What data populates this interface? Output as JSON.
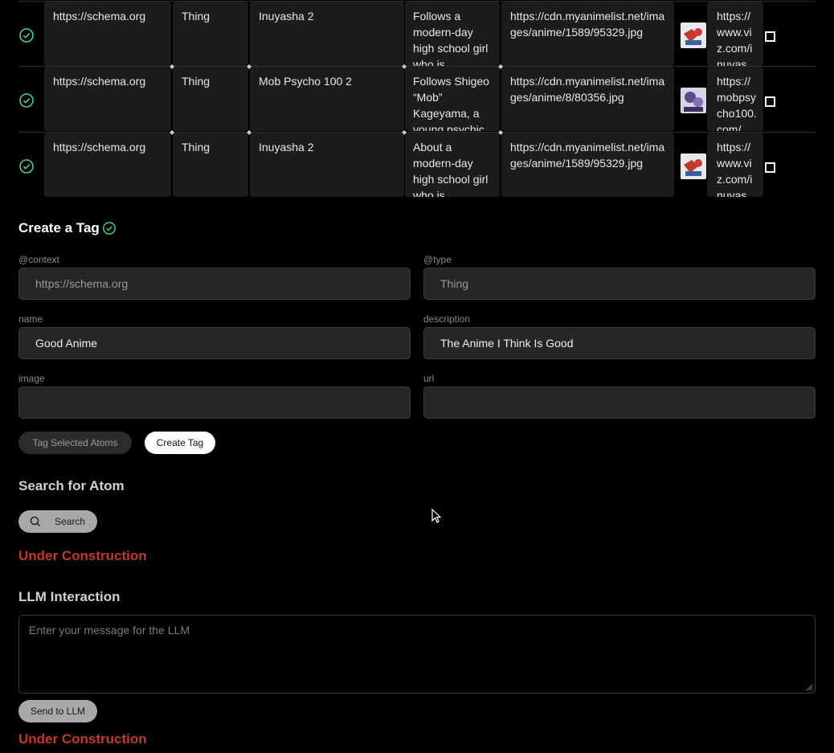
{
  "rows": [
    {
      "context": "https://schema.org",
      "type": "Thing",
      "name": "Inuyasha 2",
      "description": "Follows a modern-day high school girl who is",
      "image": "https://cdn.myanimelist.net/images/anime/1589/95329.jpg",
      "url": "https://www.viz.com/inuyas",
      "thumb_color": "#c0392b"
    },
    {
      "context": "https://schema.org",
      "type": "Thing",
      "name": "Mob Psycho 100 2",
      "description": "Follows Shigeo “Mob” Kageyama, a young psychic",
      "image": "https://cdn.myanimelist.net/images/anime/8/80356.jpg",
      "url": "https://mobpsycho100.com/",
      "thumb_color": "#5b4b8a"
    },
    {
      "context": "https://schema.org",
      "type": "Thing",
      "name": "Inuyasha 2",
      "description": "About a modern-day high school girl who is",
      "image": "https://cdn.myanimelist.net/images/anime/1589/95329.jpg",
      "url": "https://www.viz.com/inuyas",
      "thumb_color": "#c0392b"
    }
  ],
  "create_tag": {
    "title": "Create a Tag",
    "context_label": "@context",
    "context_value": "https://schema.org",
    "type_label": "@type",
    "type_value": "Thing",
    "name_label": "name",
    "name_value": "Good Anime",
    "description_label": "description",
    "description_value": "The Anime I Think Is Good",
    "image_label": "image",
    "image_value": "",
    "url_label": "url",
    "url_value": "",
    "tag_selected_label": "Tag Selected Atoms",
    "create_label": "Create Tag"
  },
  "search": {
    "title": "Search for Atom",
    "button_label": "Search",
    "status": "Under Construction"
  },
  "llm": {
    "title": "LLM Interaction",
    "placeholder": "Enter your message for the LLM",
    "send_label": "Send to LLM",
    "status": "Under Construction"
  },
  "colors": {
    "accent_green": "#4cd08a",
    "warning_red": "#c0392b"
  }
}
